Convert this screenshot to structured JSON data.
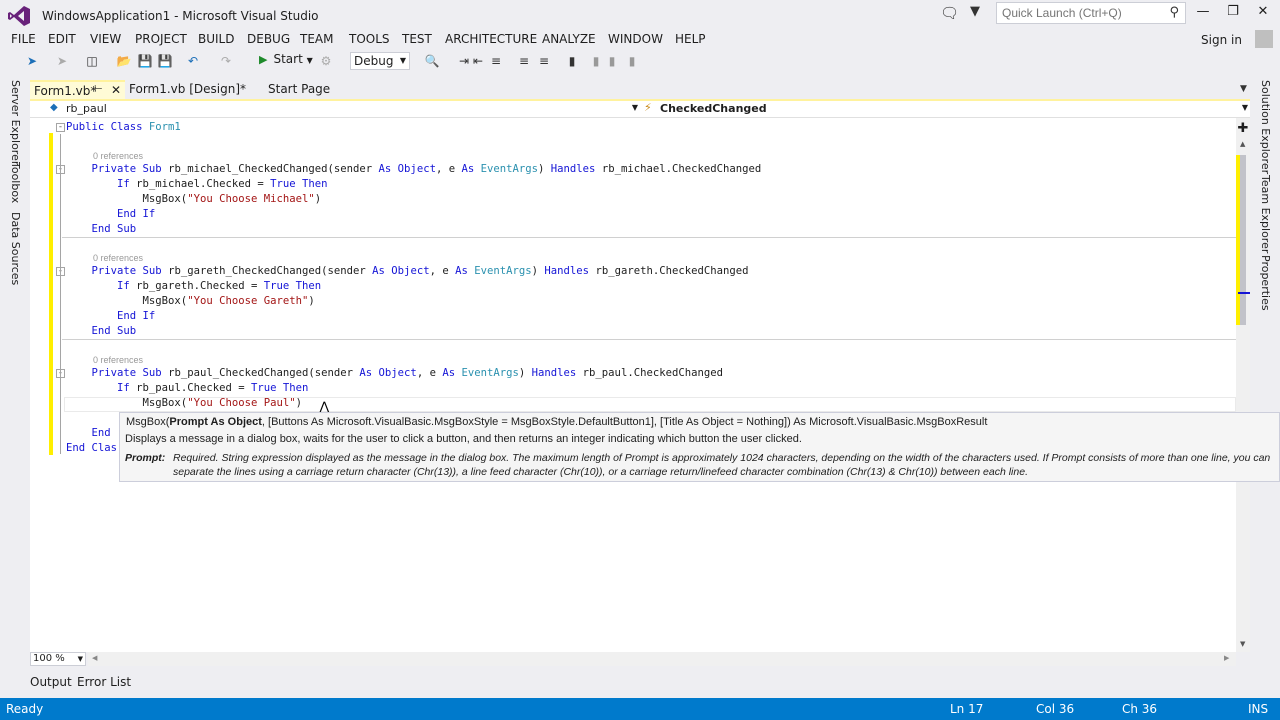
{
  "window": {
    "title": "WindowsApplication1 - Microsoft Visual Studio",
    "quick_launch_placeholder": "Quick Launch (Ctrl+Q)",
    "minimize": "—",
    "maximize": "❐",
    "close": "✕",
    "sign_in": "Sign in"
  },
  "menu": [
    "FILE",
    "EDIT",
    "VIEW",
    "PROJECT",
    "BUILD",
    "DEBUG",
    "TEAM",
    "TOOLS",
    "TEST",
    "ARCHITECTURE",
    "ANALYZE",
    "WINDOW",
    "HELP"
  ],
  "toolbar": {
    "start_label": "Start",
    "config_value": "Debug"
  },
  "left_strip": [
    "Server Explorer",
    "Toolbox",
    "Data Sources"
  ],
  "right_strip": [
    "Solution Explorer",
    "Team Explorer",
    "Properties"
  ],
  "tabs": {
    "active": "Form1.vb*",
    "design": "Form1.vb [Design]*",
    "start": "Start Page"
  },
  "navbar": {
    "object": "rb_paul",
    "event": "CheckedChanged"
  },
  "code": {
    "class_open": "Public Class Form1",
    "refs": "0 references",
    "end_class": "End Clas",
    "end_partial": "End"
  },
  "tooltip": {
    "sig_name": "MsgBox(",
    "sig_bold": "Prompt As Object",
    "sig_rest": ", [Buttons As Microsoft.VisualBasic.MsgBoxStyle = MsgBoxStyle.DefaultButton1], [Title As Object = Nothing]) As Microsoft.VisualBasic.MsgBoxResult",
    "description": "Displays a message in a dialog box, waits for the user to click a button, and then returns an integer indicating which button the user clicked.",
    "param_name": "Prompt:",
    "param_desc": "Required. String expression displayed as the message in the dialog box. The maximum length of Prompt is approximately 1024 characters, depending on the width of the characters used. If Prompt consists of more than one line, you can separate the lines using a carriage return character (Chr(13)), a line feed character (Chr(10)), or a carriage return/linefeed character combination (Chr(13) & Chr(10)) between each line."
  },
  "zoom": "100 %",
  "bottom_tabs": {
    "output": "Output",
    "error_list": "Error List"
  },
  "status": {
    "ready": "Ready",
    "line": "Ln 17",
    "col": "Col 36",
    "ch": "Ch 36",
    "mode": "INS"
  },
  "colors": {
    "accent": "#007acc",
    "keyword": "#1515d6",
    "type": "#2b91af",
    "string": "#a31515",
    "changed": "#ffef00"
  }
}
